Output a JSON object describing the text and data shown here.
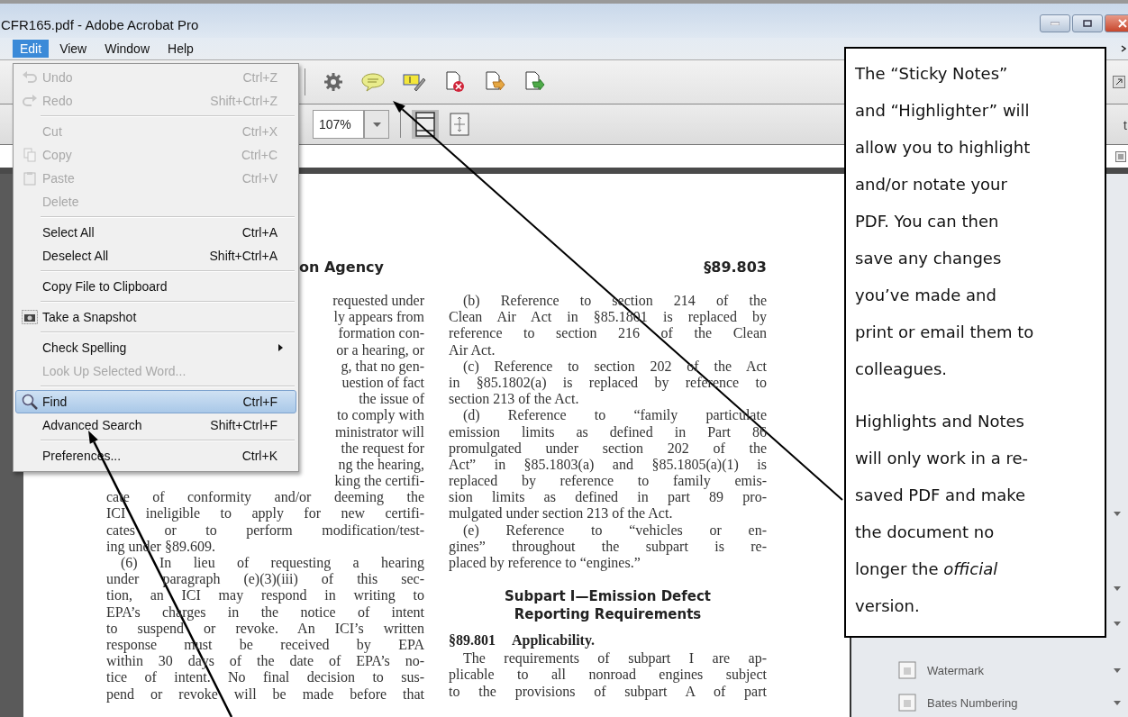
{
  "window": {
    "title": "CFR165.pdf - Adobe Acrobat Pro"
  },
  "menu_bar": [
    {
      "label": "Edit",
      "selected": true
    },
    {
      "label": "View",
      "selected": false
    },
    {
      "label": "Window",
      "selected": false
    },
    {
      "label": "Help",
      "selected": false
    }
  ],
  "toolbar": {
    "zoom": "107%",
    "side_fragment": "t"
  },
  "edit_menu": [
    {
      "kind": "item",
      "label": "Undo",
      "shortcut": "Ctrl+Z",
      "disabled": true,
      "selected": false,
      "submenu": false
    },
    {
      "kind": "item",
      "label": "Redo",
      "shortcut": "Shift+Ctrl+Z",
      "disabled": true,
      "selected": false,
      "submenu": false
    },
    {
      "kind": "separator"
    },
    {
      "kind": "item",
      "label": "Cut",
      "shortcut": "Ctrl+X",
      "disabled": true,
      "selected": false,
      "submenu": false
    },
    {
      "kind": "item",
      "label": "Copy",
      "shortcut": "Ctrl+C",
      "disabled": true,
      "selected": false,
      "submenu": false
    },
    {
      "kind": "item",
      "label": "Paste",
      "shortcut": "Ctrl+V",
      "disabled": true,
      "selected": false,
      "submenu": false
    },
    {
      "kind": "item",
      "label": "Delete",
      "disabled": true,
      "selected": false,
      "submenu": false
    },
    {
      "kind": "separator"
    },
    {
      "kind": "item",
      "label": "Select All",
      "shortcut": "Ctrl+A",
      "disabled": false,
      "selected": false,
      "submenu": false
    },
    {
      "kind": "item",
      "label": "Deselect All",
      "shortcut": "Shift+Ctrl+A",
      "disabled": false,
      "selected": false,
      "submenu": false
    },
    {
      "kind": "separator"
    },
    {
      "kind": "item",
      "label": "Copy File to Clipboard",
      "disabled": false,
      "selected": false,
      "submenu": false
    },
    {
      "kind": "separator"
    },
    {
      "kind": "item",
      "label": "Take a Snapshot",
      "disabled": false,
      "selected": false,
      "submenu": false
    },
    {
      "kind": "separator"
    },
    {
      "kind": "item",
      "label": "Check Spelling",
      "disabled": false,
      "selected": false,
      "submenu": true
    },
    {
      "kind": "item",
      "label": "Look Up Selected Word...",
      "disabled": true,
      "selected": false,
      "submenu": false
    },
    {
      "kind": "separator"
    },
    {
      "kind": "item",
      "label": "Find",
      "shortcut": "Ctrl+F",
      "disabled": false,
      "selected": true,
      "submenu": false
    },
    {
      "kind": "item",
      "label": "Advanced Search",
      "shortcut": "Shift+Ctrl+F",
      "disabled": false,
      "selected": false,
      "submenu": false
    },
    {
      "kind": "separator"
    },
    {
      "kind": "item",
      "label": "Preferences...",
      "shortcut": "Ctrl+K",
      "disabled": false,
      "selected": false,
      "submenu": false
    }
  ],
  "document": {
    "left_column": {
      "heading": "on Agency",
      "fragments": [
        "requested under",
        "ly appears from",
        "formation con-",
        "or a hearing, or",
        "g, that no gen-",
        "uestion of fact",
        "the issue of",
        "to comply with",
        "ministrator will",
        "the request for",
        "ng the hearing,",
        "king the certifi-"
      ],
      "lines": [
        {
          "text": "cate of conformity and/or deeming the",
          "kind": "body"
        },
        {
          "text": "ICI ineligible to apply for new certifi-",
          "kind": "body"
        },
        {
          "text": "cates or to perform modification/test-",
          "kind": "body"
        },
        {
          "text": "ing under §89.609.",
          "kind": "end"
        },
        {
          "text": "(6) In lieu of requesting a hearing",
          "kind": "first"
        },
        {
          "text": "under paragraph (e)(3)(iii) of this sec-",
          "kind": "body"
        },
        {
          "text": "tion, an ICI may respond in writing to",
          "kind": "body"
        },
        {
          "text": "EPA’s charges in the notice of intent",
          "kind": "body"
        },
        {
          "text": "to suspend or revoke. An ICI’s written",
          "kind": "body"
        },
        {
          "text": "response must be received by EPA",
          "kind": "body"
        },
        {
          "text": "within 30 days of the date of EPA’s no-",
          "kind": "body"
        },
        {
          "text": "tice of intent. No final decision to sus-",
          "kind": "body"
        },
        {
          "text": "pend or revoke will be made before that",
          "kind": "body"
        }
      ]
    },
    "right_column": {
      "heading": "§89.803",
      "lines": [
        {
          "text": "(b) Reference to section 214 of the",
          "kind": "first"
        },
        {
          "text": "Clean Air Act in §85.1801 is replaced by",
          "kind": "body"
        },
        {
          "text": "reference to section 216 of the Clean",
          "kind": "body"
        },
        {
          "text": "Air Act.",
          "kind": "end"
        },
        {
          "text": "(c) Reference to section 202 of the Act",
          "kind": "first"
        },
        {
          "text": "in §85.1802(a) is replaced by reference to",
          "kind": "body"
        },
        {
          "text": "section 213 of the Act.",
          "kind": "end"
        },
        {
          "text": "(d) Reference to “family particulate",
          "kind": "first"
        },
        {
          "text": "emission limits as defined in Part 86",
          "kind": "body"
        },
        {
          "text": "promulgated under section 202 of the",
          "kind": "body"
        },
        {
          "text": "Act” in §85.1803(a) and §85.1805(a)(1) is",
          "kind": "body"
        },
        {
          "text": "replaced by reference to family emis-",
          "kind": "body"
        },
        {
          "text": "sion limits as defined in part 89 pro-",
          "kind": "body"
        },
        {
          "text": "mulgated under section 213 of the Act.",
          "kind": "end"
        },
        {
          "text": "(e) Reference to “vehicles or en-",
          "kind": "first"
        },
        {
          "text": "gines” throughout the subpart is re-",
          "kind": "body"
        },
        {
          "text": "placed by reference to “engines.”",
          "kind": "end"
        }
      ],
      "subpart_heading": [
        "Subpart I—Emission Defect",
        "Reporting Requirements"
      ],
      "section": {
        "number": "§89.801",
        "title": "Applicability."
      },
      "section_lines": [
        {
          "text": "The requirements of subpart I are ap-",
          "kind": "first"
        },
        {
          "text": "plicable to all nonroad engines subject",
          "kind": "body"
        },
        {
          "text": "to the provisions of subpart A of part",
          "kind": "body"
        }
      ]
    }
  },
  "side_panel": {
    "items": [
      {
        "label": "Watermark"
      },
      {
        "label": "Bates Numbering"
      }
    ]
  },
  "callout": {
    "paragraphs": [
      [
        "The “Sticky Notes”",
        "and “Highlighter” will",
        "allow you to highlight",
        "and/or notate your",
        "PDF. You can then",
        "save any changes",
        "you’ve made and",
        "print or email them to",
        "colleagues."
      ],
      [
        "Highlights and Notes",
        "will only work in a re-",
        "saved PDF and make",
        "the document no",
        "longer the *official*",
        "version."
      ]
    ]
  }
}
